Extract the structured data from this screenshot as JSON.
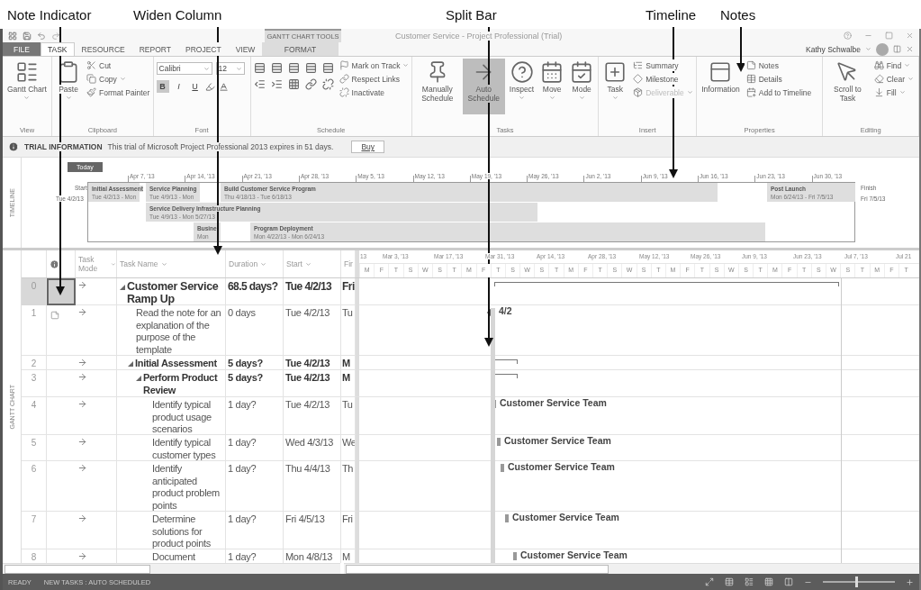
{
  "callouts": [
    "Note Indicator",
    "Widen Column",
    "Split Bar",
    "Timeline",
    "Notes"
  ],
  "window": {
    "title": "Customer Service - Project Professional (Trial)",
    "context_group": "GANTT CHART TOOLS",
    "user": "Kathy Schwalbe"
  },
  "tabs": [
    {
      "label": "FILE",
      "kind": "file",
      "selected": false
    },
    {
      "label": "TASK",
      "kind": "normal",
      "selected": true
    },
    {
      "label": "RESOURCE",
      "kind": "normal",
      "selected": false
    },
    {
      "label": "REPORT",
      "kind": "normal",
      "selected": false
    },
    {
      "label": "PROJECT",
      "kind": "normal",
      "selected": false
    },
    {
      "label": "VIEW",
      "kind": "normal",
      "selected": false
    },
    {
      "label": "FORMAT",
      "kind": "context",
      "selected": false
    }
  ],
  "ribbon": [
    {
      "label": "View",
      "items": [
        {
          "kind": "large",
          "label": "Gantt Chart",
          "dropdown": true,
          "selected": false
        }
      ]
    },
    {
      "label": "Clipboard",
      "items": [
        {
          "kind": "large",
          "label": "Paste",
          "dropdown": true,
          "selected": false
        },
        {
          "kind": "small",
          "label": "Cut"
        },
        {
          "kind": "small",
          "label": "Copy",
          "dropdown": true
        },
        {
          "kind": "small",
          "label": "Format Painter"
        }
      ]
    },
    {
      "label": "Font",
      "items": [
        {
          "kind": "combo",
          "value": "Calibri"
        },
        {
          "kind": "combo",
          "value": "12"
        },
        {
          "kind": "toggle",
          "label": "B",
          "selected": true
        },
        {
          "kind": "toggle",
          "label": "I",
          "selected": false
        },
        {
          "kind": "toggle",
          "label": "U",
          "selected": false
        }
      ]
    },
    {
      "label": "Schedule",
      "items": [
        {
          "kind": "small",
          "label": "Mark on Track",
          "dropdown": true
        },
        {
          "kind": "small",
          "label": "Respect Links"
        },
        {
          "kind": "small",
          "label": "Inactivate"
        }
      ]
    },
    {
      "label": "Tasks",
      "items": [
        {
          "kind": "large",
          "label": "Manually Schedule",
          "selected": false
        },
        {
          "kind": "large",
          "label": "Auto Schedule",
          "selected": true
        },
        {
          "kind": "large",
          "label": "Inspect",
          "dropdown": true,
          "selected": false
        },
        {
          "kind": "large",
          "label": "Move",
          "dropdown": true,
          "selected": false
        },
        {
          "kind": "large",
          "label": "Mode",
          "dropdown": true,
          "selected": false
        }
      ]
    },
    {
      "label": "Insert",
      "items": [
        {
          "kind": "large",
          "label": "Task",
          "dropdown": true,
          "selected": false
        },
        {
          "kind": "small",
          "label": "Summary"
        },
        {
          "kind": "small",
          "label": "Milestone"
        },
        {
          "kind": "small",
          "label": "Deliverable",
          "dropdown": true,
          "disabled": true
        }
      ]
    },
    {
      "label": "Properties",
      "items": [
        {
          "kind": "large",
          "label": "Information",
          "selected": false
        },
        {
          "kind": "small",
          "label": "Notes"
        },
        {
          "kind": "small",
          "label": "Details"
        },
        {
          "kind": "small",
          "label": "Add to Timeline"
        }
      ]
    },
    {
      "label": "Editing",
      "items": [
        {
          "kind": "large",
          "label": "Scroll to Task",
          "selected": false
        },
        {
          "kind": "small",
          "label": "Find",
          "dropdown": true
        },
        {
          "kind": "small",
          "label": "Clear",
          "dropdown": true
        },
        {
          "kind": "small",
          "label": "Fill",
          "dropdown": true
        }
      ]
    }
  ],
  "trial": {
    "title": "TRIAL INFORMATION",
    "message": "This trial of Microsoft Project Professional 2013 expires in 51 days.",
    "button": "Buy"
  },
  "timeline": {
    "label": "TIMELINE",
    "today": "Today",
    "start_label": "Start",
    "start_date": "Tue 4/2/13",
    "finish_label": "Finish",
    "finish_date": "Fri 7/5/13",
    "ticks": [
      "Apr 7, '13",
      "Apr 14, '13",
      "Apr 21, '13",
      "Apr 28, '13",
      "May 5, '13",
      "May 12, '13",
      "May 19, '13",
      "May 26, '13",
      "Jun 2, '13",
      "Jun 9, '13",
      "Jun 16, '13",
      "Jun 23, '13",
      "Jun 30, '13"
    ],
    "bars": [
      {
        "name": "Initial Assessment",
        "dates": "Tue 4/2/13 - Mon"
      },
      {
        "name": "Service Planning",
        "dates": "Tue 4/9/13 - Mon"
      },
      {
        "name": "Build Customer Service Program",
        "dates": "Thu 4/18/13 - Tue 6/18/13"
      },
      {
        "name": "Post Launch",
        "dates": "Mon 6/24/13 - Fri 7/5/13"
      },
      {
        "name": "Service Delivery Infrastructure Planning",
        "dates": "Tue 4/9/13 - Mon 5/27/13"
      },
      {
        "name": "Busine",
        "dates": "Mon"
      },
      {
        "name": "Program Deployment",
        "dates": "Mon 4/22/13 - Mon 6/24/13"
      }
    ]
  },
  "view_label": "GANTT CHART",
  "columns": [
    "Task Mode",
    "Task Name",
    "Duration",
    "Start",
    "Fir"
  ],
  "gantt": {
    "months": [
      "13",
      "Mar 3, '13",
      "Mar 17, '13",
      "Mar 31, '13",
      "Apr 14, '13",
      "Apr 28, '13",
      "May 12, '13",
      "May 26, '13",
      "Jun 9, '13",
      "Jun 23, '13",
      "Jul 7, '13",
      "Jul 21"
    ],
    "days": [
      "M",
      "F",
      "T",
      "S",
      "W",
      "S",
      "T",
      "M",
      "F",
      "T",
      "S",
      "W",
      "S",
      "T",
      "M",
      "F",
      "T",
      "S",
      "W",
      "S",
      "T",
      "M",
      "F",
      "T",
      "S",
      "W",
      "S",
      "T",
      "M",
      "F",
      "T",
      "S",
      "W",
      "S",
      "T",
      "M",
      "F",
      "T"
    ]
  },
  "rows": [
    {
      "id": "0",
      "name": "Customer Service Ramp Up",
      "duration": "68.5 days?",
      "start": "Tue 4/2/13",
      "finish": "Fri",
      "kind": "summary",
      "expanded": true,
      "note": false,
      "selected": true,
      "bar": {
        "kind": "summary"
      },
      "children": [
        {
          "id": "1",
          "name": "Read the note for an explanation of the purpose of the template",
          "duration": "0 days",
          "start": "Tue 4/2/13",
          "finish": "Tu",
          "kind": "task",
          "note": true,
          "selected": false,
          "bar": {
            "kind": "milestone",
            "label": "4/2"
          }
        },
        {
          "id": "2",
          "name": "Initial Assessment",
          "duration": "5 days?",
          "start": "Tue 4/2/13",
          "finish": "M",
          "kind": "summary",
          "expanded": true,
          "note": false,
          "selected": false,
          "bar": {
            "kind": "summary"
          },
          "children": [
            {
              "id": "3",
              "name": "Perform Product Review",
              "duration": "5 days?",
              "start": "Tue 4/2/13",
              "finish": "M",
              "kind": "summary",
              "expanded": true,
              "note": false,
              "selected": false,
              "bar": {
                "kind": "summary"
              },
              "children": [
                {
                  "id": "4",
                  "name": "Identify typical product usage scenarios",
                  "duration": "1 day?",
                  "start": "Tue 4/2/13",
                  "finish": "Tu",
                  "kind": "task",
                  "note": false,
                  "selected": false,
                  "bar": {
                    "kind": "task",
                    "label": "Customer Service Team"
                  }
                },
                {
                  "id": "5",
                  "name": "Identify typical customer types",
                  "duration": "1 day?",
                  "start": "Wed 4/3/13",
                  "finish": "We",
                  "kind": "task",
                  "note": false,
                  "selected": false,
                  "bar": {
                    "kind": "task",
                    "label": "Customer Service Team"
                  }
                },
                {
                  "id": "6",
                  "name": "Identify anticipated product problem points",
                  "duration": "1 day?",
                  "start": "Thu 4/4/13",
                  "finish": "Th",
                  "kind": "task",
                  "note": false,
                  "selected": false,
                  "bar": {
                    "kind": "task",
                    "label": "Customer Service Team"
                  }
                },
                {
                  "id": "7",
                  "name": "Determine solutions for product points",
                  "duration": "1 day?",
                  "start": "Fri 4/5/13",
                  "finish": "Fri",
                  "kind": "task",
                  "note": false,
                  "selected": false,
                  "bar": {
                    "kind": "task",
                    "label": "Customer Service Team"
                  }
                },
                {
                  "id": "8",
                  "name": "Document",
                  "duration": "1 day?",
                  "start": "Mon 4/8/13",
                  "finish": "M",
                  "kind": "task",
                  "note": false,
                  "selected": false,
                  "bar": {
                    "kind": "task",
                    "label": "Customer Service Team"
                  }
                }
              ]
            }
          ]
        }
      ]
    }
  ],
  "status": {
    "mode": "READY",
    "new_tasks": "NEW TASKS : AUTO SCHEDULED",
    "zoom": {
      "level": 0.45
    }
  }
}
